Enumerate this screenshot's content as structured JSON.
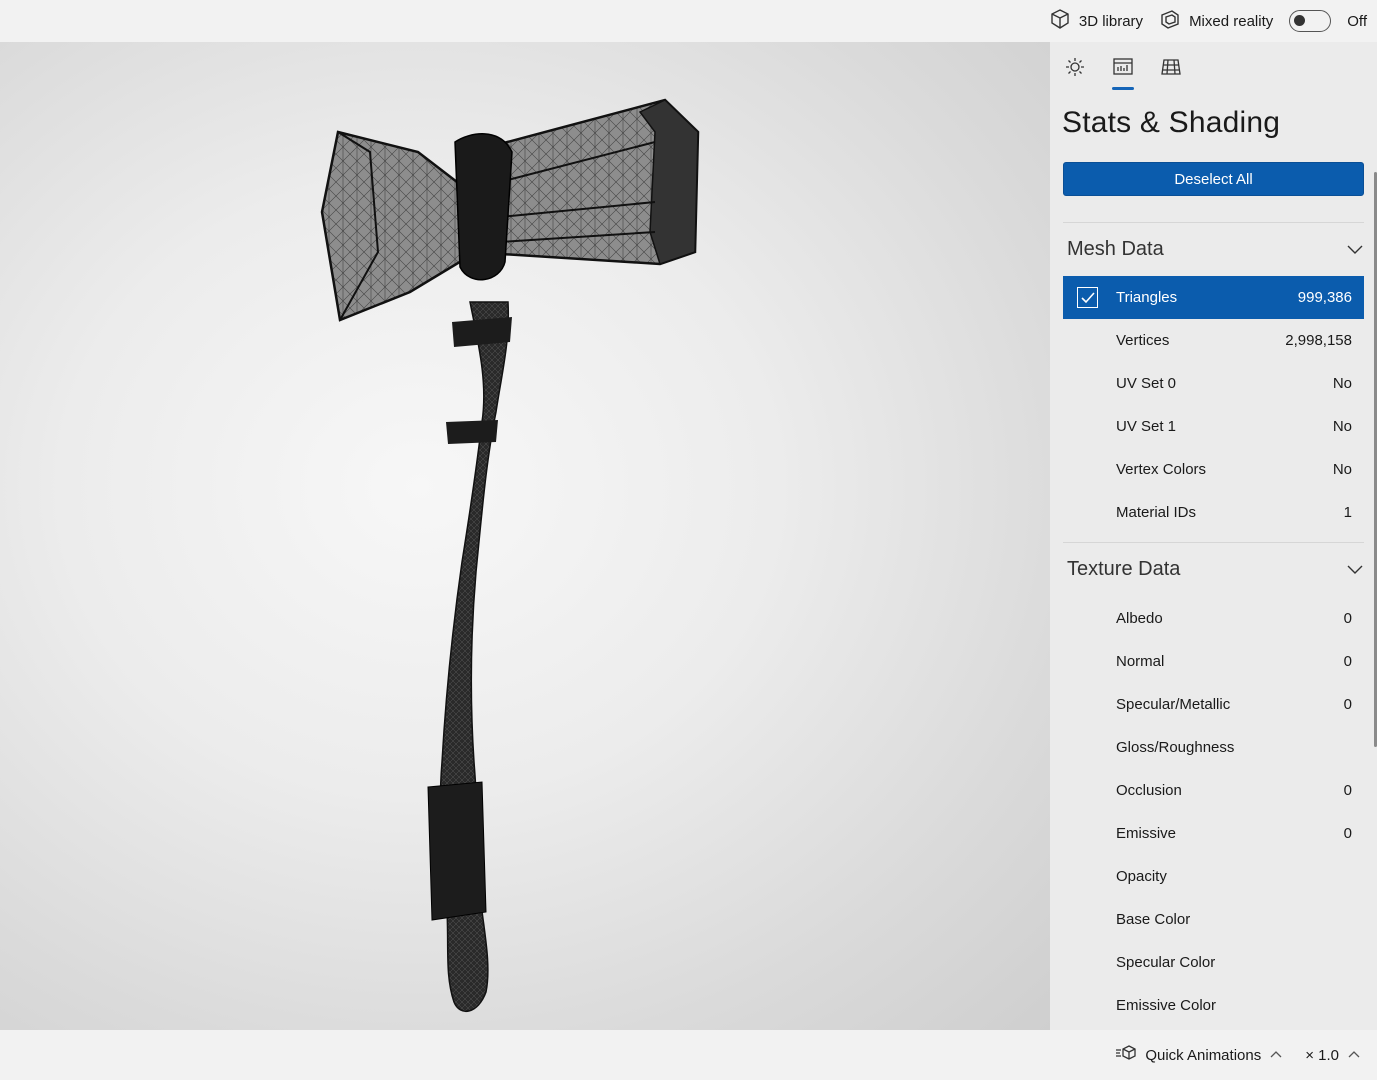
{
  "topbar": {
    "library_label": "3D library",
    "mixed_reality_label": "Mixed reality",
    "toggle_state": "Off"
  },
  "panel": {
    "title": "Stats & Shading",
    "deselect_label": "Deselect All",
    "mesh_section": {
      "title": "Mesh Data",
      "rows": [
        {
          "label": "Triangles",
          "value": "999,386",
          "selected": true
        },
        {
          "label": "Vertices",
          "value": "2,998,158"
        },
        {
          "label": "UV Set 0",
          "value": "No"
        },
        {
          "label": "UV Set 1",
          "value": "No"
        },
        {
          "label": "Vertex Colors",
          "value": "No"
        },
        {
          "label": "Material IDs",
          "value": "1"
        }
      ]
    },
    "texture_section": {
      "title": "Texture Data",
      "rows": [
        {
          "label": "Albedo",
          "value": "0"
        },
        {
          "label": "Normal",
          "value": "0"
        },
        {
          "label": "Specular/Metallic",
          "value": "0"
        },
        {
          "label": "Gloss/Roughness",
          "value": ""
        },
        {
          "label": "Occlusion",
          "value": "0"
        },
        {
          "label": "Emissive",
          "value": "0"
        },
        {
          "label": "Opacity",
          "value": ""
        },
        {
          "label": "Base Color",
          "value": ""
        },
        {
          "label": "Specular Color",
          "value": ""
        },
        {
          "label": "Emissive Color",
          "value": ""
        }
      ]
    }
  },
  "bottombar": {
    "animations_label": "Quick Animations",
    "speed_label": "× 1.0"
  },
  "colors": {
    "accent": "#0b5cad",
    "panel_bg": "#ebebeb",
    "bar_bg": "#f2f2f2"
  }
}
